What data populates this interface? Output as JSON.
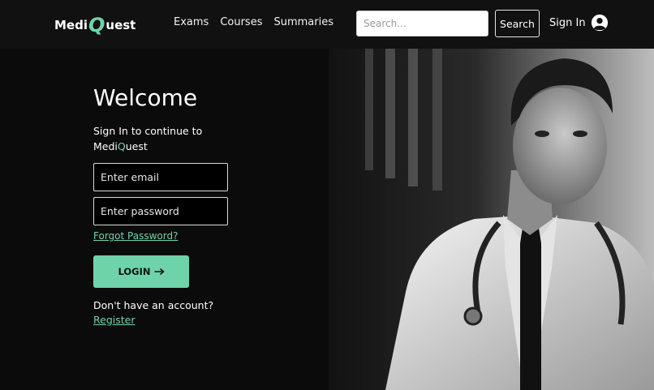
{
  "brand": {
    "part1": "Medi",
    "q": "Q",
    "part2": "uest",
    "accent": "#6fd3aa"
  },
  "nav": {
    "items": [
      "Exams",
      "Courses",
      "Summaries"
    ]
  },
  "search": {
    "placeholder": "Search...",
    "button": "Search"
  },
  "header": {
    "signin_label": "Sign In"
  },
  "login": {
    "title": "Welcome",
    "subtitle_prefix": "Sign In to continue to",
    "brand_medi": "Medi",
    "brand_q": "Q",
    "brand_uest": "uest",
    "email_placeholder": "Enter email",
    "password_placeholder": "Enter password",
    "forgot": "Forgot Password?",
    "button": "LOGIN",
    "button_icon": "arrow-right-icon",
    "no_account": "Don't have an account?",
    "register": "Register"
  },
  "hero": {
    "image": "doctor-portrait"
  }
}
